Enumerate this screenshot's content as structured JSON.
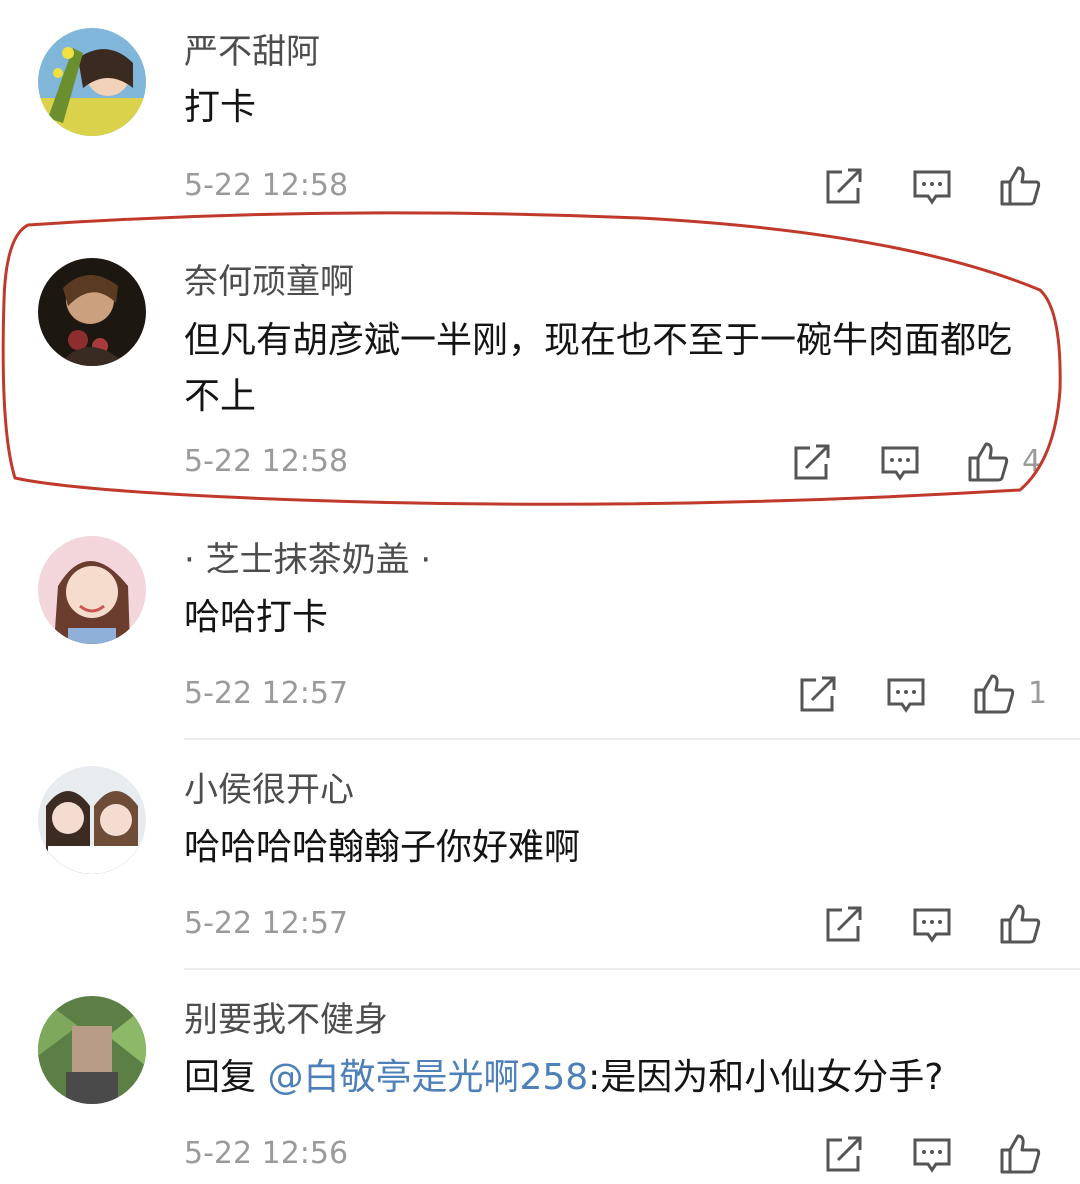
{
  "comments": [
    {
      "user": "严不甜阿",
      "text": "打卡",
      "time": "5-22 12:58",
      "likes": ""
    },
    {
      "user": "奈何顽童啊",
      "text": "但凡有胡彦斌一半刚，现在也不至于一碗牛肉面都吃不上",
      "time": "5-22 12:58",
      "likes": "4"
    },
    {
      "user": "· 芝士抹茶奶盖 ·",
      "text": "哈哈打卡",
      "time": "5-22 12:57",
      "likes": "1"
    },
    {
      "user": "小侯很开心",
      "text": "哈哈哈哈翰翰子你好难啊",
      "time": "5-22 12:57",
      "likes": ""
    },
    {
      "user": "别要我不健身",
      "reply_prefix": "回复 ",
      "mention": "@白敬亭是光啊258",
      "reply_text": ":是因为和小仙女分手?",
      "time": "5-22 12:56",
      "likes": ""
    }
  ],
  "icons": [
    "share-icon",
    "comment-icon",
    "like-icon"
  ],
  "colors": {
    "annotation": "#c0392b",
    "mention": "#4d7fb8",
    "time": "#9a9a9a"
  }
}
